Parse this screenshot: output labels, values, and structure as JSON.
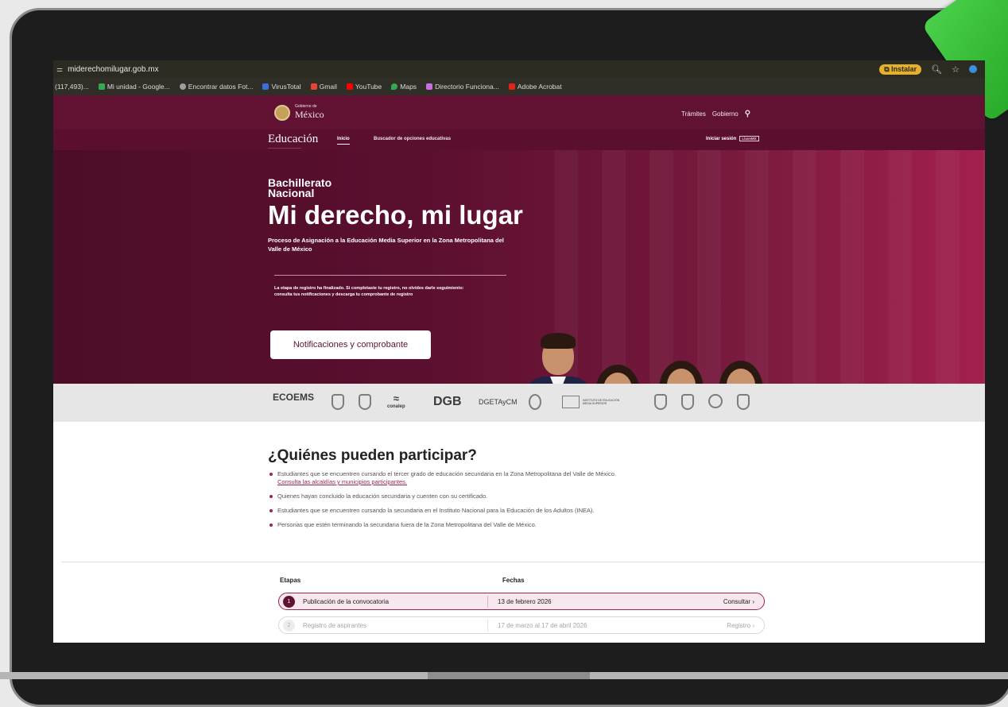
{
  "browser": {
    "url": "miderechomilugar.gob.mx",
    "install_label": "Instalar",
    "bookmarks": [
      {
        "label": "(117,493)...",
        "color": "#2b2b22"
      },
      {
        "label": "Mi unidad - Google...",
        "color": "#34a853"
      },
      {
        "label": "Encontrar datos Fot...",
        "color": "#9e9e9e"
      },
      {
        "label": "VirusTotal",
        "color": "#3b6fd8"
      },
      {
        "label": "Gmail",
        "color": "#ea4335"
      },
      {
        "label": "YouTube",
        "color": "#ff0000"
      },
      {
        "label": "Maps",
        "color": "#34a853"
      },
      {
        "label": "Directorio Funciona...",
        "color": "#c86fe0"
      },
      {
        "label": "Adobe Acrobat",
        "color": "#e2231a"
      }
    ]
  },
  "gov_header": {
    "logo_small": "Gobierno de",
    "logo_big": "México",
    "tramites": "Trámites",
    "gobierno": "Gobierno"
  },
  "edu_nav": {
    "brand": "Educación",
    "inicio": "Inicio",
    "buscador": "Buscador de opciones educativas",
    "login": "Iniciar sesión",
    "llave": "LlaveMX"
  },
  "hero": {
    "eyebrow": "Bachillerato Nacional",
    "title": "Mi derecho, mi lugar",
    "subtitle": "Proceso de Asignación a la Educación Media Superior en la Zona Metropolitana del Valle de México",
    "notice": "La etapa de registro ha finalizado. Si completaste tu registro, no olvides darle seguimiento: consulta tus notificaciones y descarga tu comprobante de registro",
    "button": "Notificaciones y comprobante"
  },
  "logos": {
    "ecoems": "ECOEMS",
    "conalep": "conalep",
    "dgb": "DGB",
    "dgetaycm": "DGETAyCM",
    "instituto": "INSTITUTO DE EDUCACIÓN MEDIA SUPERIOR"
  },
  "who": {
    "title": "¿Quiénes pueden participar?",
    "items": [
      "Estudiantes que se encuentren cursando el tercer grado de educación secundaria en la Zona Metropolitana del Valle de México.",
      "Quienes hayan concluido la educación secundaria y cuenten con su certificado.",
      "Estudiantes que se encuentren cursando la secundaria en el Instituto Nacional para la Educación de los Adultos (INEA).",
      "Personas que estén terminando la secundaria fuera de la Zona Metropolitana del Valle de México."
    ],
    "link": "Consulta las alcaldías y municipios participantes."
  },
  "stages": {
    "header_etapas": "Etapas",
    "header_fechas": "Fechas",
    "rows": [
      {
        "num": "1",
        "label": "Publicación de la convocatoria",
        "date": "13 de febrero 2026",
        "action": "Consultar"
      },
      {
        "num": "2",
        "label": "Registro de aspirantes",
        "date": "17 de marzo al 17 de abril 2026",
        "action": "Registro"
      }
    ]
  },
  "colors": {
    "guinda": "#611232",
    "accent": "#9d2449"
  }
}
